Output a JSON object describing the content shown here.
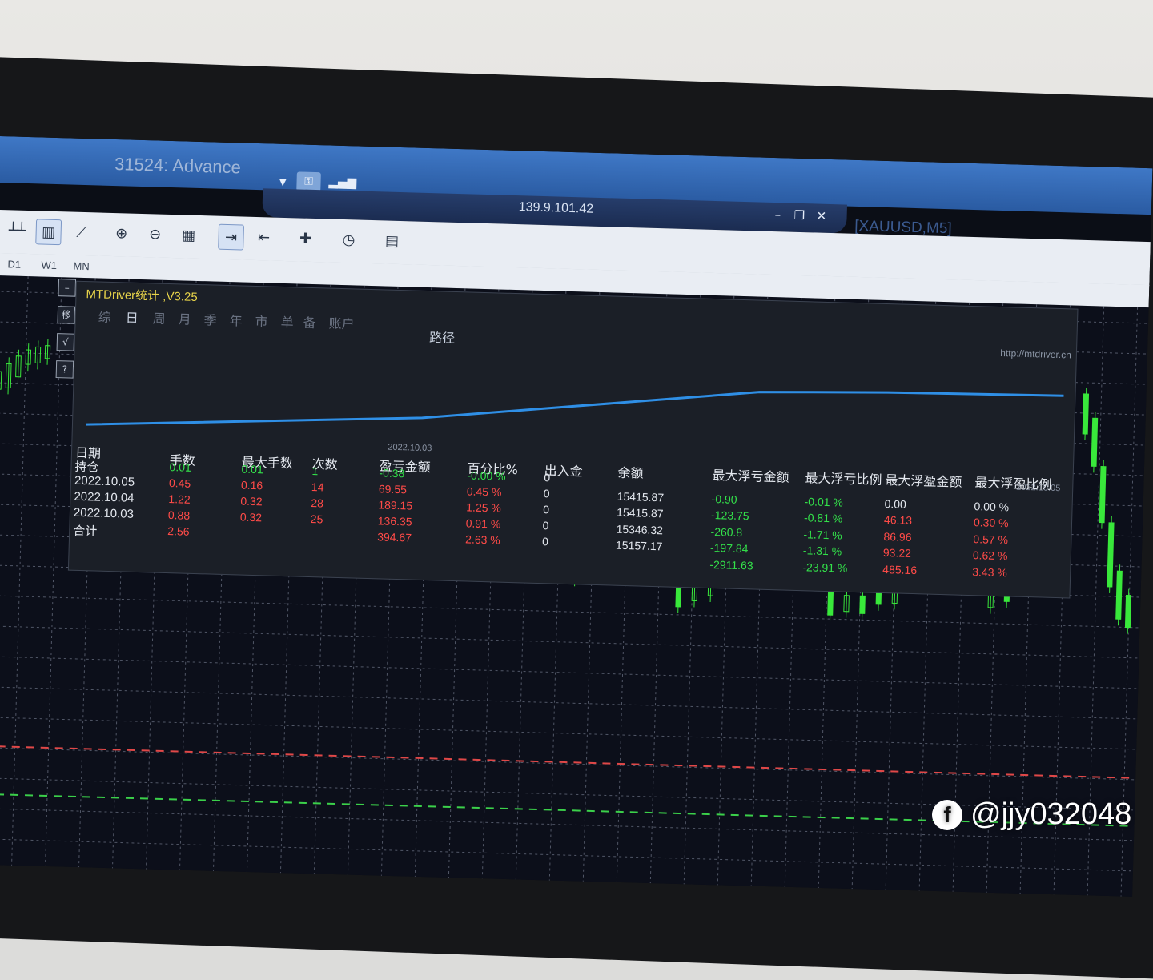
{
  "window": {
    "title": "31524: Advance",
    "remote_ip": "139.9.101.42",
    "symbol_tab": "[XAUUSD,M5]",
    "min_btn": "–",
    "restore_btn": "❐",
    "close_btn": "✕"
  },
  "toolbar": {
    "icons": [
      "bar-chart-icon",
      "candlestick-icon",
      "line-chart-icon",
      "zoom-in-icon",
      "zoom-out-icon",
      "tile-windows-icon",
      "autoscroll-icon",
      "chart-shift-icon",
      "indicators-icon",
      "periods-icon",
      "templates-icon"
    ]
  },
  "periods": [
    "D1",
    "W1",
    "MN"
  ],
  "panel": {
    "title": "MTDriver统计 ,V3.25",
    "menu": [
      "综",
      "日",
      "周",
      "月",
      "季",
      "年",
      "市",
      "单",
      "备",
      "账户"
    ],
    "active_menu": "日",
    "path_label": "路径",
    "url": "http://mtdriver.cn",
    "date_start": "2022.10.03",
    "date_end": "2022.10.05",
    "side_buttons": [
      "–",
      "移",
      "√",
      "?"
    ]
  },
  "table": {
    "headers": [
      "日期",
      "手数",
      "最大手数",
      "次数",
      "盈亏金额",
      "百分比%",
      "出入金",
      "余额",
      "最大浮亏金额",
      "最大浮亏比例",
      "最大浮盈金额",
      "最大浮盈比例"
    ],
    "rows": [
      {
        "date": "持仓",
        "lots": "0.01",
        "max_lots": "0.01",
        "count": "1",
        "pnl": "-0.38",
        "pct": "-0.00 %",
        "io": "0",
        "balance": "",
        "max_float_loss": "",
        "max_float_loss_pct": "",
        "max_float_profit": "",
        "max_float_profit_pct": ""
      },
      {
        "date": "2022.10.05",
        "lots": "0.45",
        "max_lots": "0.16",
        "count": "14",
        "pnl": "69.55",
        "pct": "0.45 %",
        "io": "0",
        "balance": "15415.87",
        "max_float_loss": "-0.90",
        "max_float_loss_pct": "-0.01 %",
        "max_float_profit": "0.00",
        "max_float_profit_pct": "0.00 %"
      },
      {
        "date": "2022.10.04",
        "lots": "1.22",
        "max_lots": "0.32",
        "count": "28",
        "pnl": "189.15",
        "pct": "1.25 %",
        "io": "0",
        "balance": "15415.87",
        "max_float_loss": "-123.75",
        "max_float_loss_pct": "-0.81 %",
        "max_float_profit": "46.13",
        "max_float_profit_pct": "0.30 %"
      },
      {
        "date": "2022.10.03",
        "lots": "0.88",
        "max_lots": "0.32",
        "count": "25",
        "pnl": "136.35",
        "pct": "0.91 %",
        "io": "0",
        "balance": "15346.32",
        "max_float_loss": "-260.8",
        "max_float_loss_pct": "-1.71 %",
        "max_float_profit": "86.96",
        "max_float_profit_pct": "0.57 %"
      },
      {
        "date": "合计",
        "lots": "2.56",
        "max_lots": "",
        "count": "",
        "pnl": "394.67",
        "pct": "2.63 %",
        "io": "0",
        "balance": "15157.17",
        "max_float_loss": "-197.84",
        "max_float_loss_pct": "-1.31 %",
        "max_float_profit": "93.22",
        "max_float_profit_pct": "0.62 %"
      },
      {
        "date": "",
        "lots": "",
        "max_lots": "",
        "count": "",
        "pnl": "",
        "pct": "",
        "io": "",
        "balance": "",
        "max_float_loss": "-2911.63",
        "max_float_loss_pct": "-23.91 %",
        "max_float_profit": "485.16",
        "max_float_profit_pct": "3.43 %"
      }
    ]
  },
  "watermark": "@jjy032048",
  "watermark_logo": "f",
  "colors": {
    "positive": "#33e24a",
    "negative": "#ff4b48",
    "curve": "#2f8fe6",
    "candle": "#39e83b"
  }
}
